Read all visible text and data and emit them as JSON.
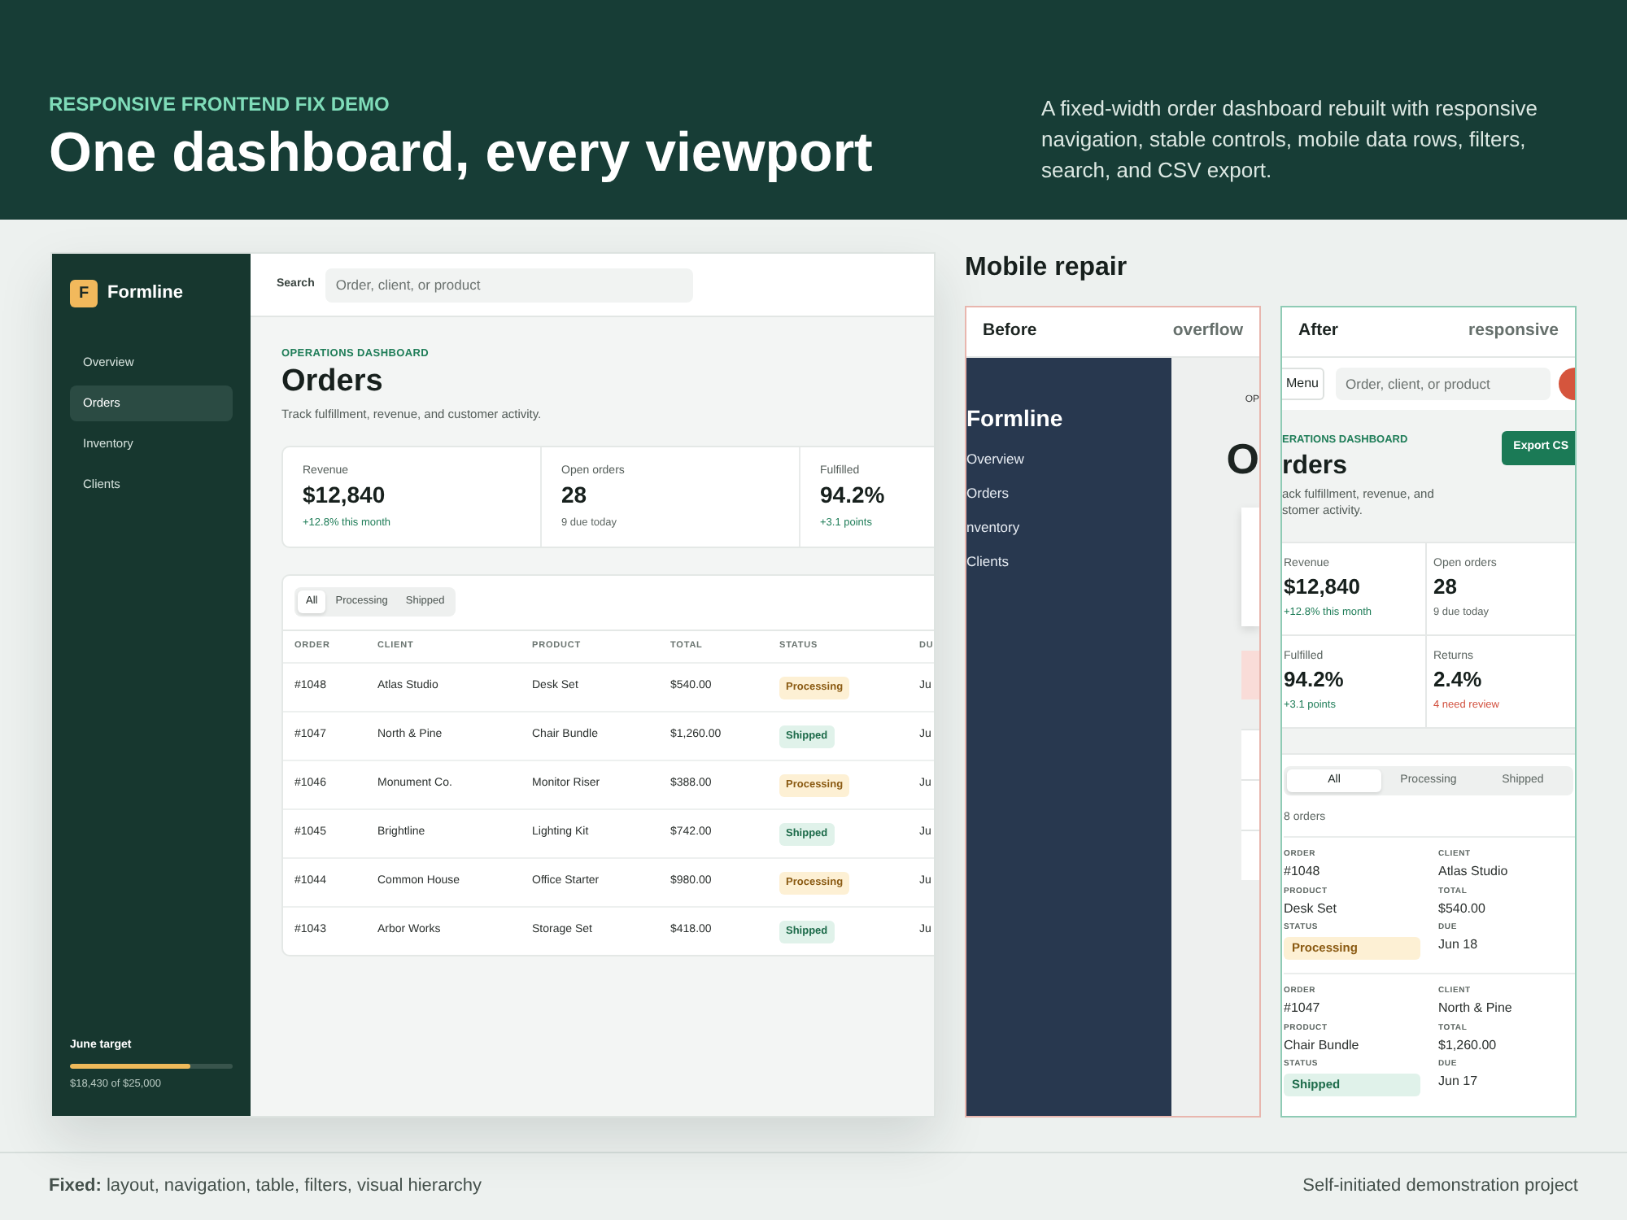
{
  "header": {
    "kicker": "RESPONSIVE FRONTEND FIX DEMO",
    "title": "One dashboard, every viewport",
    "description": "A fixed-width order dashboard rebuilt with responsive navigation, stable controls, mobile data rows, filters, search, and CSV export."
  },
  "desktop": {
    "brand": {
      "initial": "F",
      "name": "Formline"
    },
    "nav": [
      {
        "label": "Overview",
        "selected": false
      },
      {
        "label": "Orders",
        "selected": true
      },
      {
        "label": "Inventory",
        "selected": false
      },
      {
        "label": "Clients",
        "selected": false
      }
    ],
    "target": {
      "label": "June target",
      "level": 0.74,
      "caption": "$18,430 of $25,000"
    },
    "search": {
      "label": "Search",
      "placeholder": "Order, client, or product"
    },
    "kicker": "OPERATIONS DASHBOARD",
    "title": "Orders",
    "subtitle": "Track fulfillment, revenue, and customer activity.",
    "stats": [
      {
        "label": "Revenue",
        "value": "$12,840",
        "note": "+12.8% this month",
        "color": "#1f7d58"
      },
      {
        "label": "Open orders",
        "value": "28",
        "note": "9 due today",
        "color": "#5d6662"
      },
      {
        "label": "Fulfilled",
        "value": "94.2%",
        "note": "+3.1 points",
        "color": "#1f7d58"
      }
    ],
    "filters": [
      {
        "label": "All",
        "selected": true
      },
      {
        "label": "Processing",
        "selected": false
      },
      {
        "label": "Shipped",
        "selected": false
      }
    ],
    "table": {
      "columns": [
        "ORDER",
        "CLIENT",
        "PRODUCT",
        "TOTAL",
        "STATUS",
        "DU"
      ],
      "rows": [
        {
          "order": "#1048",
          "client": "Atlas Studio",
          "product": "Desk Set",
          "total": "$540.00",
          "status": "Processing",
          "kind": "processing",
          "due": "Ju"
        },
        {
          "order": "#1047",
          "client": "North & Pine",
          "product": "Chair Bundle",
          "total": "$1,260.00",
          "status": "Shipped",
          "kind": "shipped",
          "due": "Ju"
        },
        {
          "order": "#1046",
          "client": "Monument Co.",
          "product": "Monitor Riser",
          "total": "$388.00",
          "status": "Processing",
          "kind": "processing",
          "due": "Ju"
        },
        {
          "order": "#1045",
          "client": "Brightline",
          "product": "Lighting Kit",
          "total": "$742.00",
          "status": "Shipped",
          "kind": "shipped",
          "due": "Ju"
        },
        {
          "order": "#1044",
          "client": "Common House",
          "product": "Office Starter",
          "total": "$980.00",
          "status": "Processing",
          "kind": "processing",
          "due": "Ju"
        },
        {
          "order": "#1043",
          "client": "Arbor Works",
          "product": "Storage Set",
          "total": "$418.00",
          "status": "Shipped",
          "kind": "shipped",
          "due": "Ju"
        }
      ]
    }
  },
  "mobile": {
    "title": "Mobile repair",
    "before": {
      "label": "Before",
      "tag": "overflow",
      "brand": "Formline",
      "nav": [
        "Overview",
        "Orders",
        "nventory",
        "Clients"
      ],
      "kicker": "OP",
      "title": "O"
    },
    "after": {
      "label": "After",
      "tag": "responsive",
      "menu": "Menu",
      "search_placeholder": "Order, client, or product",
      "kicker": "ERATIONS DASHBOARD",
      "title": "rders",
      "subtitle_lines": [
        "ack fulfillment, revenue, and",
        "stomer activity."
      ],
      "export": "Export CS",
      "stats": [
        {
          "label": "Revenue",
          "value": "$12,840",
          "note": "+12.8% this month",
          "color": "#1f7d58"
        },
        {
          "label": "Open orders",
          "value": "28",
          "note": "9 due today",
          "color": "#5d6662"
        },
        {
          "label": "Fulfilled",
          "value": "94.2%",
          "note": "+3.1 points",
          "color": "#1f7d58"
        },
        {
          "label": "Returns",
          "value": "2.4%",
          "note": "4 need review",
          "color": "#d2513f"
        }
      ],
      "filters": [
        {
          "label": "All",
          "selected": true
        },
        {
          "label": "Processing",
          "selected": false
        },
        {
          "label": "Shipped",
          "selected": false
        }
      ],
      "count": "8 orders",
      "orders": [
        {
          "fields": [
            {
              "label": "ORDER",
              "value": "#1048",
              "kind": "text"
            },
            {
              "label": "CLIENT",
              "value": "Atlas Studio",
              "kind": "text"
            },
            {
              "label": "PRODUCT",
              "value": "Desk Set",
              "kind": "text"
            },
            {
              "label": "TOTAL",
              "value": "$540.00",
              "kind": "text"
            },
            {
              "label": "STATUS",
              "value": "Processing",
              "kind": "processing"
            },
            {
              "label": "DUE",
              "value": "Jun 18",
              "kind": "text"
            }
          ]
        },
        {
          "fields": [
            {
              "label": "ORDER",
              "value": "#1047",
              "kind": "text"
            },
            {
              "label": "CLIENT",
              "value": "North & Pine",
              "kind": "text"
            },
            {
              "label": "PRODUCT",
              "value": "Chair Bundle",
              "kind": "text"
            },
            {
              "label": "TOTAL",
              "value": "$1,260.00",
              "kind": "text"
            },
            {
              "label": "STATUS",
              "value": "Shipped",
              "kind": "shipped"
            },
            {
              "label": "DUE",
              "value": "Jun 17",
              "kind": "text"
            }
          ]
        }
      ]
    }
  },
  "footer": {
    "fixed": "**Fixed:** layout, navigation, table, filters, visual hierarchy",
    "credit": "Self-initiated demonstration project"
  }
}
